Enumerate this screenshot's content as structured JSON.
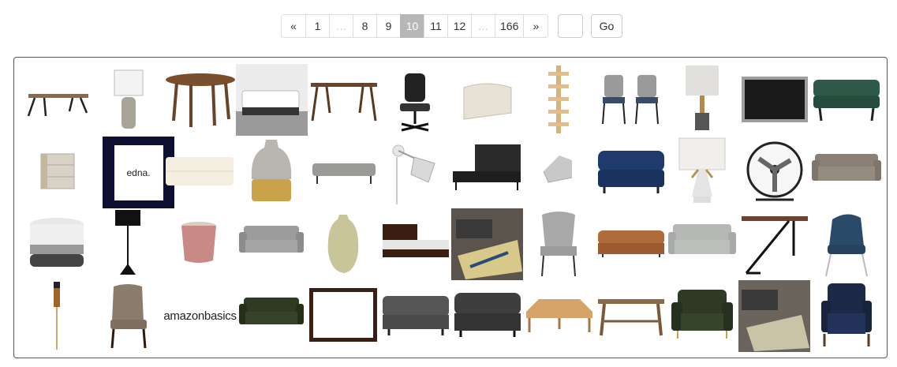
{
  "pagination": {
    "prev_label": "«",
    "next_label": "»",
    "pages": [
      "1",
      "…",
      "8",
      "9",
      "10",
      "11",
      "12",
      "…",
      "166"
    ],
    "current_page": "10",
    "page_input_value": "",
    "go_label": "Go"
  },
  "products": [
    {
      "icon": "desk-icon"
    },
    {
      "icon": "table-lamp-icon"
    },
    {
      "icon": "round-table-icon"
    },
    {
      "icon": "bed-frame-icon"
    },
    {
      "icon": "writing-desk-icon"
    },
    {
      "icon": "office-chair-icon"
    },
    {
      "icon": "headboard-icon"
    },
    {
      "icon": "wall-shelf-icon"
    },
    {
      "icon": "dining-chairs-icon"
    },
    {
      "icon": "table-lamp-icon"
    },
    {
      "icon": "chalkboard-icon"
    },
    {
      "icon": "ottoman-icon"
    },
    {
      "icon": "nightstand-icon"
    },
    {
      "icon": "photo-frame-icon",
      "caption": "edna."
    },
    {
      "icon": "bench-ottoman-icon"
    },
    {
      "icon": "vase-icon"
    },
    {
      "icon": "bench-icon"
    },
    {
      "icon": "wall-lamp-icon"
    },
    {
      "icon": "platform-bed-icon"
    },
    {
      "icon": "floor-chair-icon"
    },
    {
      "icon": "ottoman-icon"
    },
    {
      "icon": "table-lamp-icon"
    },
    {
      "icon": "desk-fan-icon"
    },
    {
      "icon": "sofa-icon"
    },
    {
      "icon": "pouf-icon"
    },
    {
      "icon": "floor-lamp-icon"
    },
    {
      "icon": "planter-icon"
    },
    {
      "icon": "sofa-icon"
    },
    {
      "icon": "vase-icon"
    },
    {
      "icon": "bed-icon"
    },
    {
      "icon": "living-room-icon"
    },
    {
      "icon": "accent-chair-icon"
    },
    {
      "icon": "chesterfield-sofa-icon"
    },
    {
      "icon": "sofa-icon"
    },
    {
      "icon": "standing-desk-icon"
    },
    {
      "icon": "accent-chair-icon"
    },
    {
      "icon": "tiki-torch-icon"
    },
    {
      "icon": "dining-chair-icon"
    },
    {
      "icon": "brand-logo-icon",
      "caption": "amazonbasics"
    },
    {
      "icon": "loveseat-icon"
    },
    {
      "icon": "mirror-frame-icon"
    },
    {
      "icon": "ottoman-icon"
    },
    {
      "icon": "ottoman-icon"
    },
    {
      "icon": "bench-icon"
    },
    {
      "icon": "console-table-icon"
    },
    {
      "icon": "armchair-icon"
    },
    {
      "icon": "living-room-icon"
    },
    {
      "icon": "armless-chair-icon"
    }
  ]
}
